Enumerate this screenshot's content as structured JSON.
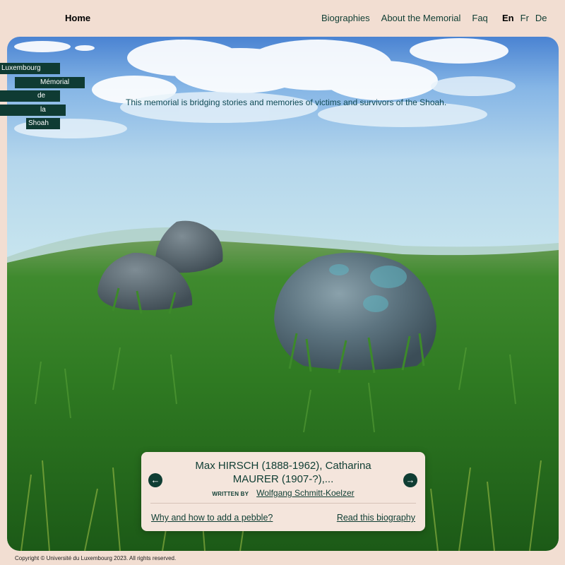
{
  "header": {
    "home_label": "Home",
    "nav": [
      "Biographies",
      "About the Memorial",
      "Faq"
    ],
    "languages": [
      {
        "label": "En",
        "active": true
      },
      {
        "label": "Fr",
        "active": false
      },
      {
        "label": "De",
        "active": false
      }
    ]
  },
  "logo": {
    "words": [
      "Luxembourg",
      "Mémorial",
      "de",
      "la",
      "Shoah"
    ]
  },
  "hero": {
    "tagline": "This memorial is bridging stories and memories of victims and survivors of the Shoah."
  },
  "bio_card": {
    "title": "Max HIRSCH (1888-1962), Catharina MAURER (1907-?),...",
    "written_by_label": "WRITTEN BY",
    "author": "Wolfgang Schmitt-Koelzer",
    "prev_icon": "arrow-left-icon",
    "next_icon": "arrow-right-icon",
    "pebble_link": "Why and how to add a pebble?",
    "read_link": "Read this biography"
  },
  "footer": {
    "copyright": "Copyright © Université du Luxembourg 2023. All rights reserved."
  },
  "colors": {
    "page_bg": "#f2ded2",
    "accent": "#0f3d33",
    "card_bg": "#f4e5dc"
  }
}
